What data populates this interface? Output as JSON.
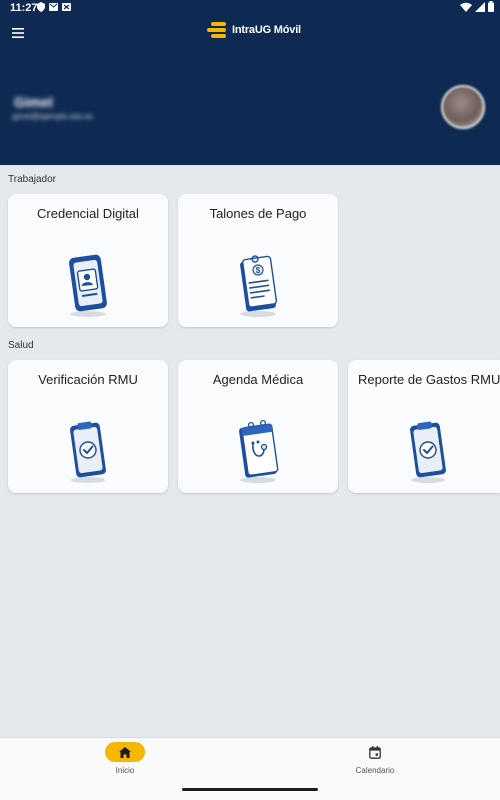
{
  "status_bar": {
    "time": "11:27",
    "left_icons": [
      "shield-icon",
      "mail-icon",
      "image-icon"
    ],
    "right_icons": [
      "wifi-icon",
      "signal-icon",
      "battery-icon"
    ]
  },
  "header": {
    "menu_icon": "menu-icon",
    "app_title": "IntraUG Móvil",
    "background_color": "#0e2a52",
    "accent_color": "#f5b700"
  },
  "user": {
    "name": "Gimel",
    "email": "gimel@ejemplo.edu.ec"
  },
  "sections": [
    {
      "label": "Trabajador",
      "cards": [
        {
          "title": "Credencial Digital",
          "icon": "phone-id-icon"
        },
        {
          "title": "Talones de Pago",
          "icon": "pay-stub-icon"
        }
      ]
    },
    {
      "label": "Salud",
      "cards": [
        {
          "title": "Verificación RMU",
          "icon": "clipboard-check-icon"
        },
        {
          "title": "Agenda Médica",
          "icon": "medical-calendar-icon"
        },
        {
          "title": "Reporte de Gastos RMU",
          "icon": "clipboard-check-icon"
        }
      ]
    }
  ],
  "bottom_nav": [
    {
      "label": "Inicio",
      "icon": "home-icon",
      "active": true
    },
    {
      "label": "Calendario",
      "icon": "calendar-icon",
      "active": false
    }
  ]
}
